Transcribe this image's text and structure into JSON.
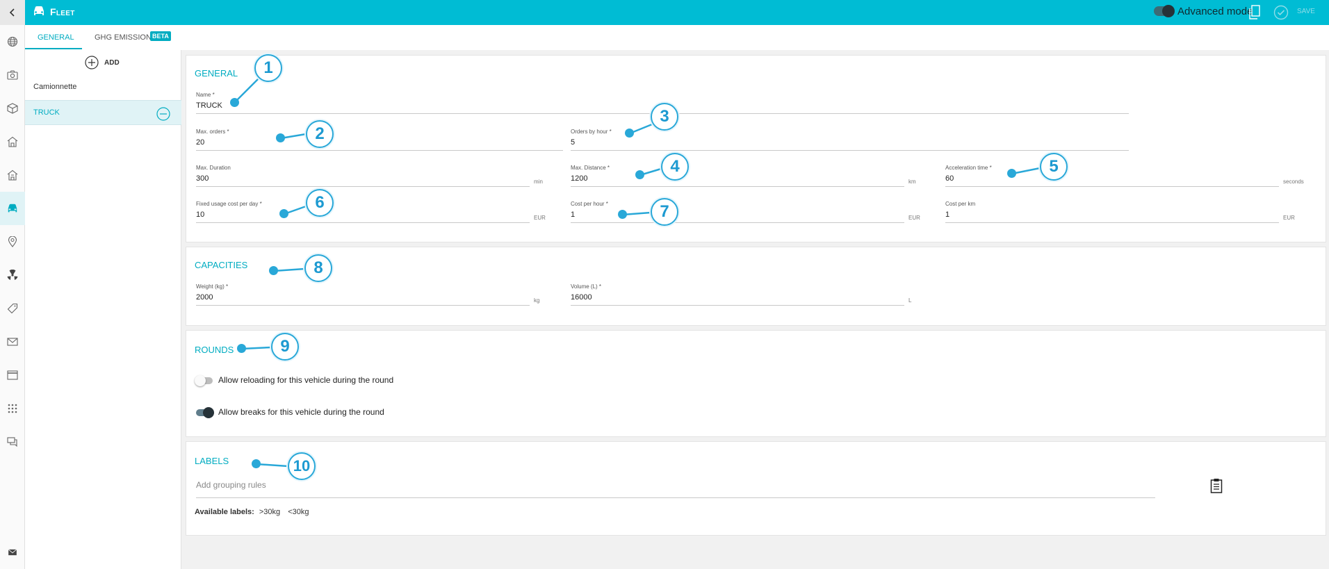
{
  "app": {
    "title": "Fleet",
    "advanced_mode_label": "Advanced mode",
    "save_label": "SAVE",
    "accent": "#00bcd4"
  },
  "tabs": [
    {
      "label": "GENERAL",
      "active": true
    },
    {
      "label": "GHG EMISSIONS",
      "badge": "BETA",
      "active": false
    }
  ],
  "vehicles": {
    "add_label": "ADD",
    "items": [
      {
        "name": "Camionnette",
        "selected": false
      },
      {
        "name": "TRUCK",
        "selected": true
      }
    ]
  },
  "general": {
    "title": "GENERAL",
    "name": {
      "label": "Name *",
      "value": "TRUCK"
    },
    "max_orders": {
      "label": "Max. orders *",
      "value": "20"
    },
    "orders_by_hour": {
      "label": "Orders by hour *",
      "value": "5"
    },
    "max_duration": {
      "label": "Max. Duration",
      "value": "300",
      "unit": "min"
    },
    "max_distance": {
      "label": "Max. Distance *",
      "value": "1200",
      "unit": "km"
    },
    "acceleration_time": {
      "label": "Acceleration time *",
      "value": "60",
      "unit": "seconds"
    },
    "fixed_cost_day": {
      "label": "Fixed usage cost per day *",
      "value": "10",
      "unit": "EUR"
    },
    "cost_per_hour": {
      "label": "Cost per hour *",
      "value": "1",
      "unit": "EUR"
    },
    "cost_per_km": {
      "label": "Cost per km",
      "value": "1",
      "unit": "EUR"
    }
  },
  "capacities": {
    "title": "CAPACITIES",
    "weight": {
      "label": "Weight (kg) *",
      "value": "2000",
      "unit": "kg"
    },
    "volume": {
      "label": "Volume (L) *",
      "value": "16000",
      "unit": "L"
    }
  },
  "rounds": {
    "title": "ROUNDS",
    "reload": {
      "label": "Allow reloading for this vehicle during the round",
      "on": false
    },
    "breaks": {
      "label": "Allow breaks for this vehicle during the round",
      "on": true
    }
  },
  "labels": {
    "title": "LABELS",
    "placeholder": "Add grouping rules",
    "available_title": "Available labels:",
    "available": [
      ">30kg",
      "<30kg"
    ]
  },
  "callouts": [
    "1",
    "2",
    "3",
    "4",
    "5",
    "6",
    "7",
    "8",
    "9",
    "10"
  ]
}
